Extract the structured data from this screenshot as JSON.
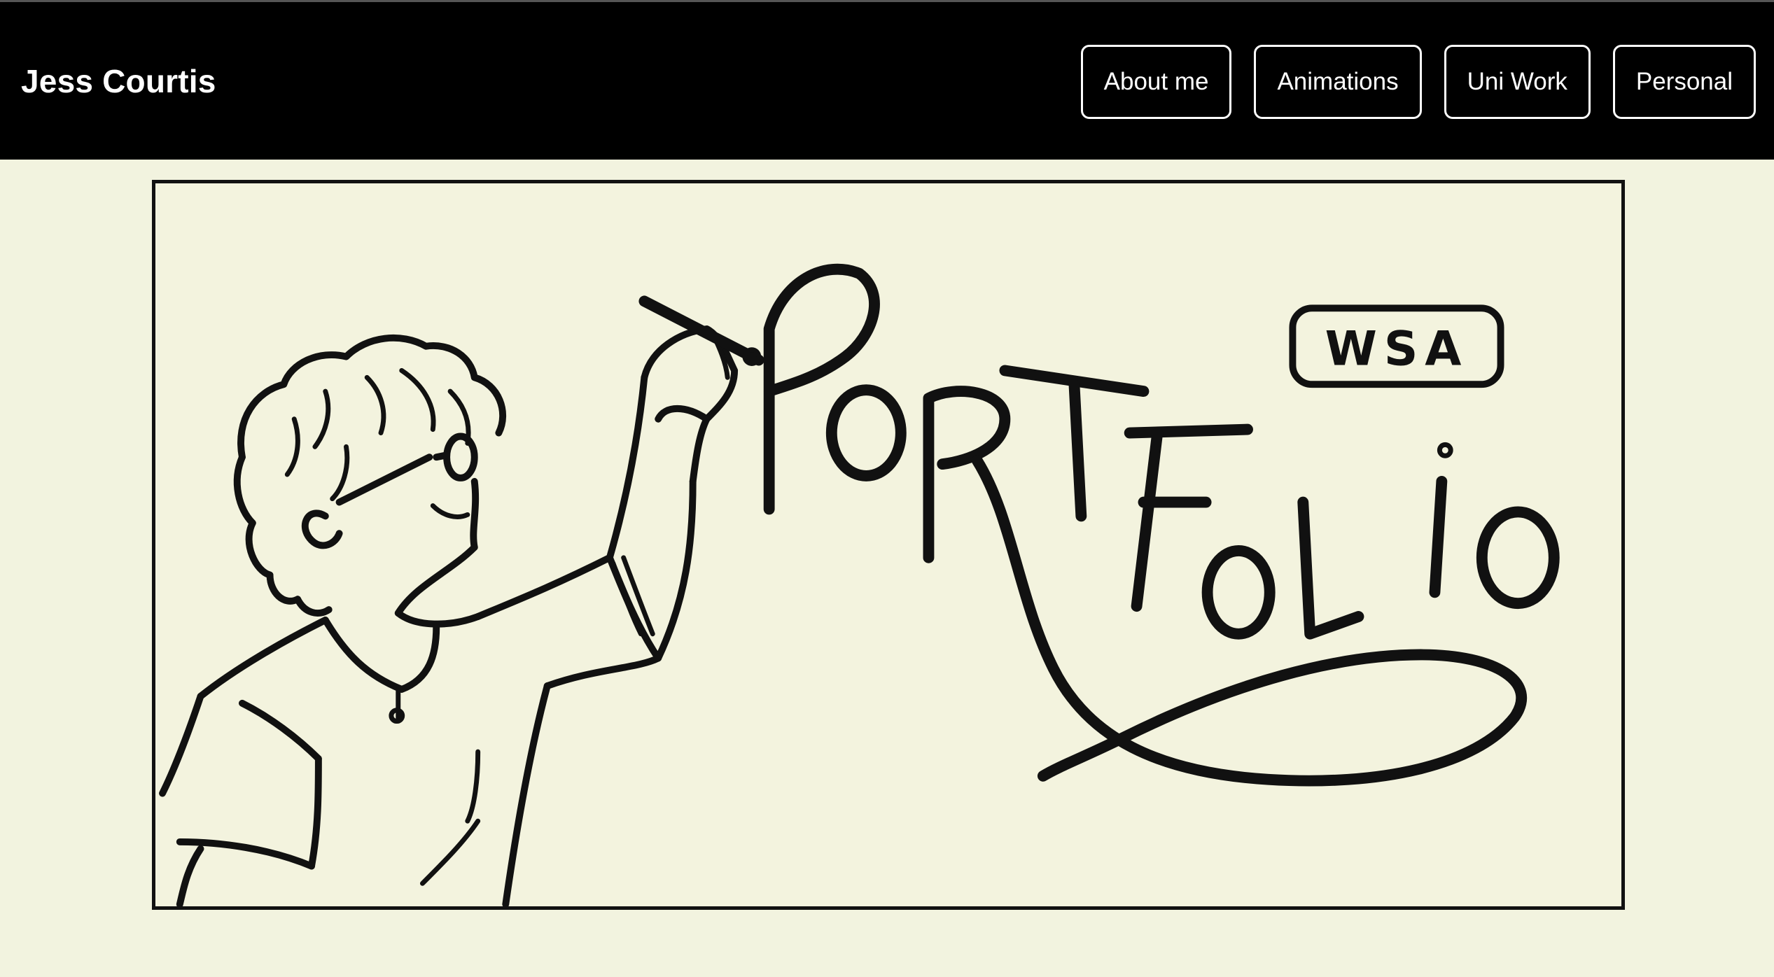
{
  "header": {
    "site_title": "Jess Courtis",
    "nav": [
      {
        "label": "About me"
      },
      {
        "label": "Animations"
      },
      {
        "label": "Uni Work"
      },
      {
        "label": "Personal"
      }
    ]
  },
  "hero": {
    "word": "PORTFOLIO",
    "badge": "WSA"
  },
  "colors": {
    "header_bg": "#000000",
    "page_bg": "#f2f3df",
    "ink": "#111111"
  }
}
